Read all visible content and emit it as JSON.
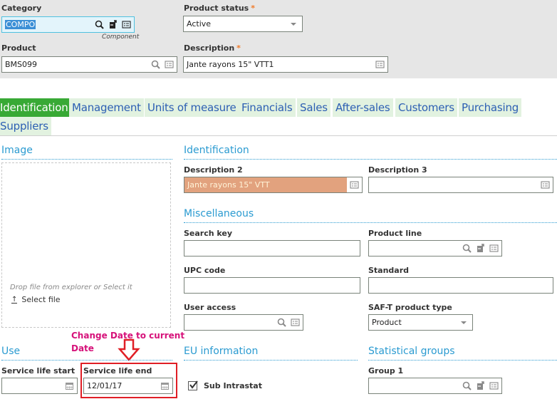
{
  "header": {
    "category": {
      "label": "Category",
      "value": "COMPO",
      "hint": "Component"
    },
    "product_status": {
      "label": "Product status",
      "required_mark": "*",
      "value": "Active"
    },
    "product": {
      "label": "Product",
      "value": "BMS099"
    },
    "description": {
      "label": "Description",
      "required_mark": "*",
      "value": "Jante rayons 15\" VTT1"
    }
  },
  "tabs": [
    {
      "label": "Identification",
      "active": true
    },
    {
      "label": "Management"
    },
    {
      "label": "Units of measure"
    },
    {
      "label": "Financials"
    },
    {
      "label": "Sales"
    },
    {
      "label": "After-sales"
    },
    {
      "label": "Customers"
    },
    {
      "label": "Purchasing"
    },
    {
      "label": "Suppliers"
    }
  ],
  "image_section": {
    "title": "Image",
    "drop_text": "Drop file from explorer or Select it",
    "select_file_label": "Select file"
  },
  "identification_section": {
    "title": "Identification",
    "description2": {
      "label": "Description 2",
      "value": "Jante rayons 15\" VTT"
    },
    "description3": {
      "label": "Description 3",
      "value": ""
    }
  },
  "misc_section": {
    "title": "Miscellaneous",
    "search_key": {
      "label": "Search key",
      "value": ""
    },
    "product_line": {
      "label": "Product line",
      "value": ""
    },
    "upc_code": {
      "label": "UPC code",
      "value": ""
    },
    "standard": {
      "label": "Standard",
      "value": ""
    },
    "user_access": {
      "label": "User access",
      "value": ""
    },
    "saft_type": {
      "label": "SAF-T product type",
      "value": "Product"
    }
  },
  "use_section": {
    "title": "Use",
    "service_life_start": {
      "label": "Service life start",
      "value": ""
    },
    "service_life_end": {
      "label": "Service life end",
      "value": "12/01/17"
    }
  },
  "eu_section": {
    "title": "EU information",
    "sub_intrastat": {
      "label": "Sub Intrastat",
      "checked": true
    }
  },
  "stat_section": {
    "title": "Statistical groups",
    "group1": {
      "label": "Group 1",
      "value": ""
    }
  },
  "annotation": {
    "text_line1": "Change Date to current",
    "text_line2": "Date",
    "color": "#d6127a",
    "box_color": "#e01e25"
  },
  "colors": {
    "active_tab": "#38a935",
    "tab_bg": "#e2f2e0",
    "tab_text": "#2d5fb3",
    "section_title": "#2b9bd1",
    "required": "#f07b2a",
    "description2_bg": "#e2a27e"
  }
}
